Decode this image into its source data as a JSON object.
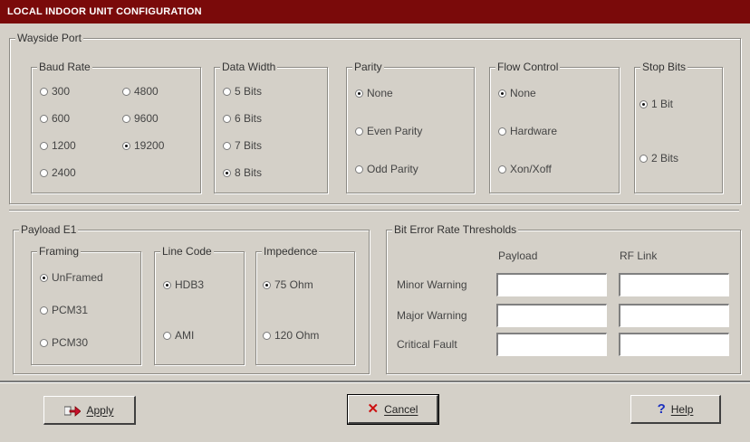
{
  "window": {
    "title": "LOCAL INDOOR UNIT CONFIGURATION"
  },
  "wayside": {
    "legend": "Wayside Port",
    "baud": {
      "legend": "Baud Rate",
      "options": [
        "300",
        "4800",
        "600",
        "9600",
        "1200",
        "19200",
        "2400"
      ],
      "selected": "19200"
    },
    "data_width": {
      "legend": "Data Width",
      "options": [
        "5 Bits",
        "6 Bits",
        "7 Bits",
        "8 Bits"
      ],
      "selected": "8 Bits"
    },
    "parity": {
      "legend": "Parity",
      "options": [
        "None",
        "Even Parity",
        "Odd Parity"
      ],
      "selected": "None"
    },
    "flow": {
      "legend": "Flow Control",
      "options": [
        "None",
        "Hardware",
        "Xon/Xoff"
      ],
      "selected": "None"
    },
    "stop": {
      "legend": "Stop Bits",
      "options": [
        "1 Bit",
        "2 Bits"
      ],
      "selected": "1 Bit"
    }
  },
  "payload": {
    "legend": "Payload E1",
    "framing": {
      "legend": "Framing",
      "options": [
        "UnFramed",
        "PCM31",
        "PCM30"
      ],
      "selected": "UnFramed"
    },
    "line_code": {
      "legend": "Line Code",
      "options": [
        "HDB3",
        "AMI"
      ],
      "selected": "HDB3"
    },
    "impedance": {
      "legend": "Impedence",
      "options": [
        "75 Ohm",
        "120 Ohm"
      ],
      "selected": "75 Ohm"
    }
  },
  "ber": {
    "legend": "Bit Error Rate Thresholds",
    "columns": [
      "Payload",
      "RF Link"
    ],
    "rows": [
      {
        "label": "Minor Warning",
        "payload": "",
        "rf": ""
      },
      {
        "label": "Major Warning",
        "payload": "",
        "rf": ""
      },
      {
        "label": "Critical Fault",
        "payload": "",
        "rf": ""
      }
    ]
  },
  "buttons": {
    "apply": "Apply",
    "cancel": "Cancel",
    "help": "Help"
  },
  "colors": {
    "title_bar": "#7a0a0a",
    "face": "#d4d0c8"
  }
}
